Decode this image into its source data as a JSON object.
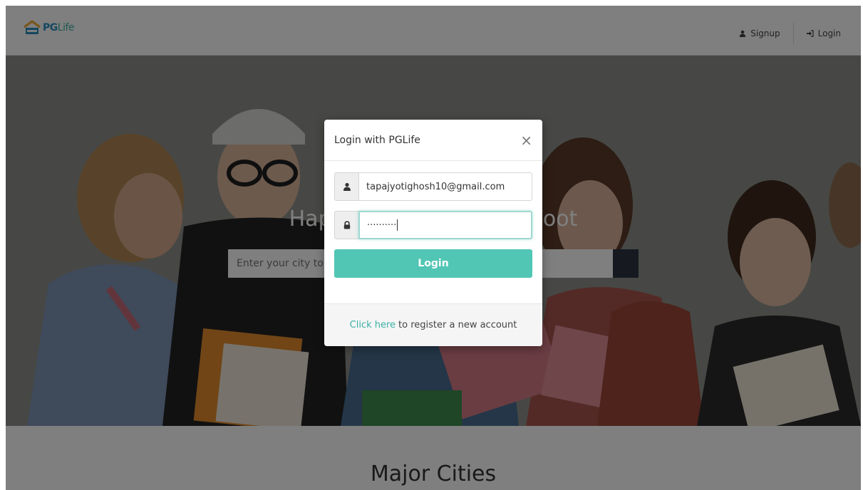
{
  "brand": {
    "name_pg": "PG",
    "name_life": "Life"
  },
  "nav": {
    "signup": "Signup",
    "login": "Login"
  },
  "hero": {
    "title": "Happiness per Square Foot",
    "search_placeholder": "Enter your city to search for PGs"
  },
  "sections": {
    "cities_title": "Major Cities"
  },
  "modal": {
    "title": "Login with PGLife",
    "close": "×",
    "email_value": "tapajyotighosh10@gmail.com",
    "password_mask": "··········",
    "login_button": "Login",
    "footer_link": "Click here",
    "footer_text": "to register a new account"
  },
  "icons": {
    "user": "user-icon",
    "lock": "lock-icon",
    "search": "search-icon",
    "signup": "user-icon",
    "login": "sign-in-icon",
    "logo": "house-icon"
  },
  "colors": {
    "accent": "#51c6b4",
    "link": "#3ab0a6",
    "brand_blue": "#2a8fc0",
    "search_button": "#2c3440"
  }
}
